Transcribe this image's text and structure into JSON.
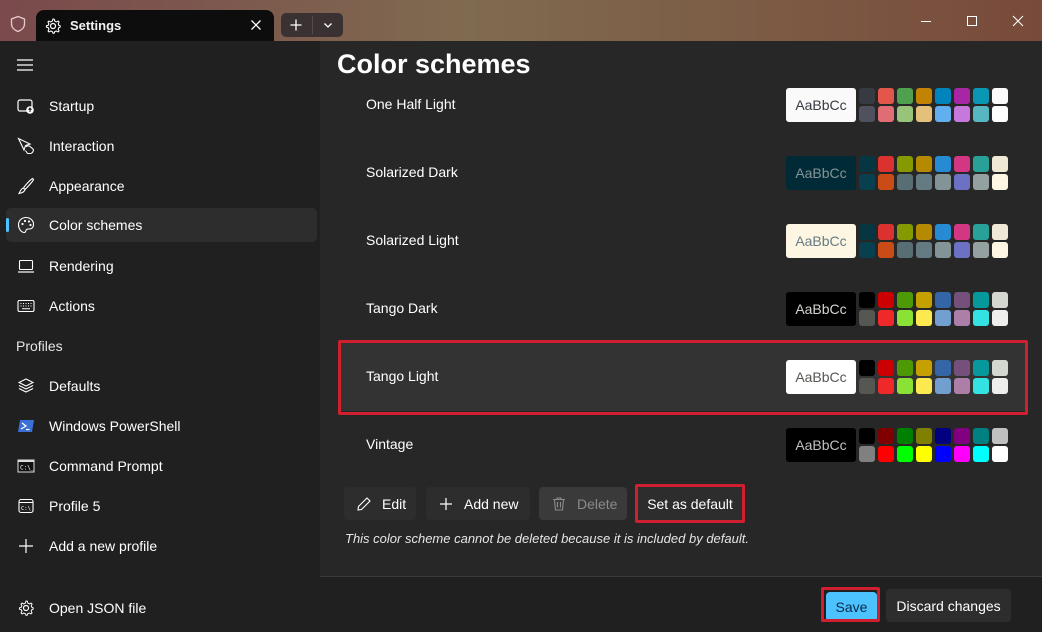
{
  "window": {
    "tab_title": "Settings",
    "tab_icon": "gear-icon",
    "new_tab_icon": "plus-icon",
    "dropdown_icon": "chevron-down-icon",
    "controls": [
      "minimize-icon",
      "maximize-icon",
      "close-icon"
    ]
  },
  "sidebar": {
    "menu_icon": "hamburger-icon",
    "items": [
      {
        "label": "Startup",
        "icon": "startup-icon"
      },
      {
        "label": "Interaction",
        "icon": "interaction-icon"
      },
      {
        "label": "Appearance",
        "icon": "brush-icon"
      },
      {
        "label": "Color schemes",
        "icon": "palette-icon",
        "active": true
      },
      {
        "label": "Rendering",
        "icon": "laptop-icon"
      },
      {
        "label": "Actions",
        "icon": "keyboard-icon"
      }
    ],
    "profiles_header": "Profiles",
    "profiles": [
      {
        "label": "Defaults",
        "icon": "layers-icon"
      },
      {
        "label": "Windows PowerShell",
        "icon": "powershell-icon"
      },
      {
        "label": "Command Prompt",
        "icon": "cmd-icon"
      },
      {
        "label": "Profile 5",
        "icon": "terminal-icon"
      },
      {
        "label": "Add a new profile",
        "icon": "plus-icon"
      }
    ],
    "open_json": {
      "label": "Open JSON file",
      "icon": "gear-icon"
    }
  },
  "main": {
    "title": "Color schemes",
    "preview_text": "AaBbCc",
    "schemes": [
      {
        "name": "One Half Light",
        "preview_bg": "#fafafa",
        "preview_fg": "#383a42",
        "colors": [
          "#383a42",
          "#e45649",
          "#50a14f",
          "#c18301",
          "#0184bc",
          "#a626a4",
          "#0997b3",
          "#fafafa",
          "#4f525e",
          "#e06c75",
          "#98c379",
          "#e5c07b",
          "#61afef",
          "#c678dd",
          "#56b6c2",
          "#ffffff"
        ]
      },
      {
        "name": "Solarized Dark",
        "preview_bg": "#002b36",
        "preview_fg": "#839496",
        "colors": [
          "#073642",
          "#dc322f",
          "#859900",
          "#b58900",
          "#268bd2",
          "#d33682",
          "#2aa198",
          "#eee8d5",
          "#08404f",
          "#cb4b16",
          "#586e75",
          "#657b83",
          "#839496",
          "#6c71c4",
          "#93a1a1",
          "#fdf6e3"
        ]
      },
      {
        "name": "Solarized Light",
        "preview_bg": "#fdf6e3",
        "preview_fg": "#657b83",
        "colors": [
          "#073642",
          "#dc322f",
          "#859900",
          "#b58900",
          "#268bd2",
          "#d33682",
          "#2aa198",
          "#eee8d5",
          "#08404f",
          "#cb4b16",
          "#586e75",
          "#657b83",
          "#839496",
          "#6c71c4",
          "#93a1a1",
          "#fdf6e3"
        ]
      },
      {
        "name": "Tango Dark",
        "preview_bg": "#000000",
        "preview_fg": "#d3d7cf",
        "colors": [
          "#000000",
          "#cc0000",
          "#4e9a06",
          "#c4a000",
          "#3465a4",
          "#75507b",
          "#06989a",
          "#d3d7cf",
          "#555753",
          "#ef2929",
          "#8ae234",
          "#fce94f",
          "#729fcf",
          "#ad7fa8",
          "#34e2e2",
          "#eeeeec"
        ]
      },
      {
        "name": "Tango Light",
        "preview_bg": "#ffffff",
        "preview_fg": "#555753",
        "selected": true,
        "colors": [
          "#000000",
          "#cc0000",
          "#4e9a06",
          "#c4a000",
          "#3465a4",
          "#75507b",
          "#06989a",
          "#d3d7cf",
          "#555753",
          "#ef2929",
          "#8ae234",
          "#fce94f",
          "#729fcf",
          "#ad7fa8",
          "#34e2e2",
          "#eeeeec"
        ]
      },
      {
        "name": "Vintage",
        "preview_bg": "#000000",
        "preview_fg": "#c0c0c0",
        "colors": [
          "#000000",
          "#800000",
          "#008000",
          "#808000",
          "#000080",
          "#800080",
          "#008080",
          "#c0c0c0",
          "#808080",
          "#ff0000",
          "#00ff00",
          "#ffff00",
          "#0000ff",
          "#ff00ff",
          "#00ffff",
          "#ffffff"
        ]
      }
    ],
    "actions": {
      "edit": "Edit",
      "add_new": "Add new",
      "delete": "Delete",
      "set_default": "Set as default"
    },
    "note": "This color scheme cannot be deleted because it is included by default."
  },
  "footer": {
    "save": "Save",
    "discard": "Discard changes"
  },
  "colors": {
    "accent": "#4cc2ff",
    "highlight": "#d0202f"
  }
}
